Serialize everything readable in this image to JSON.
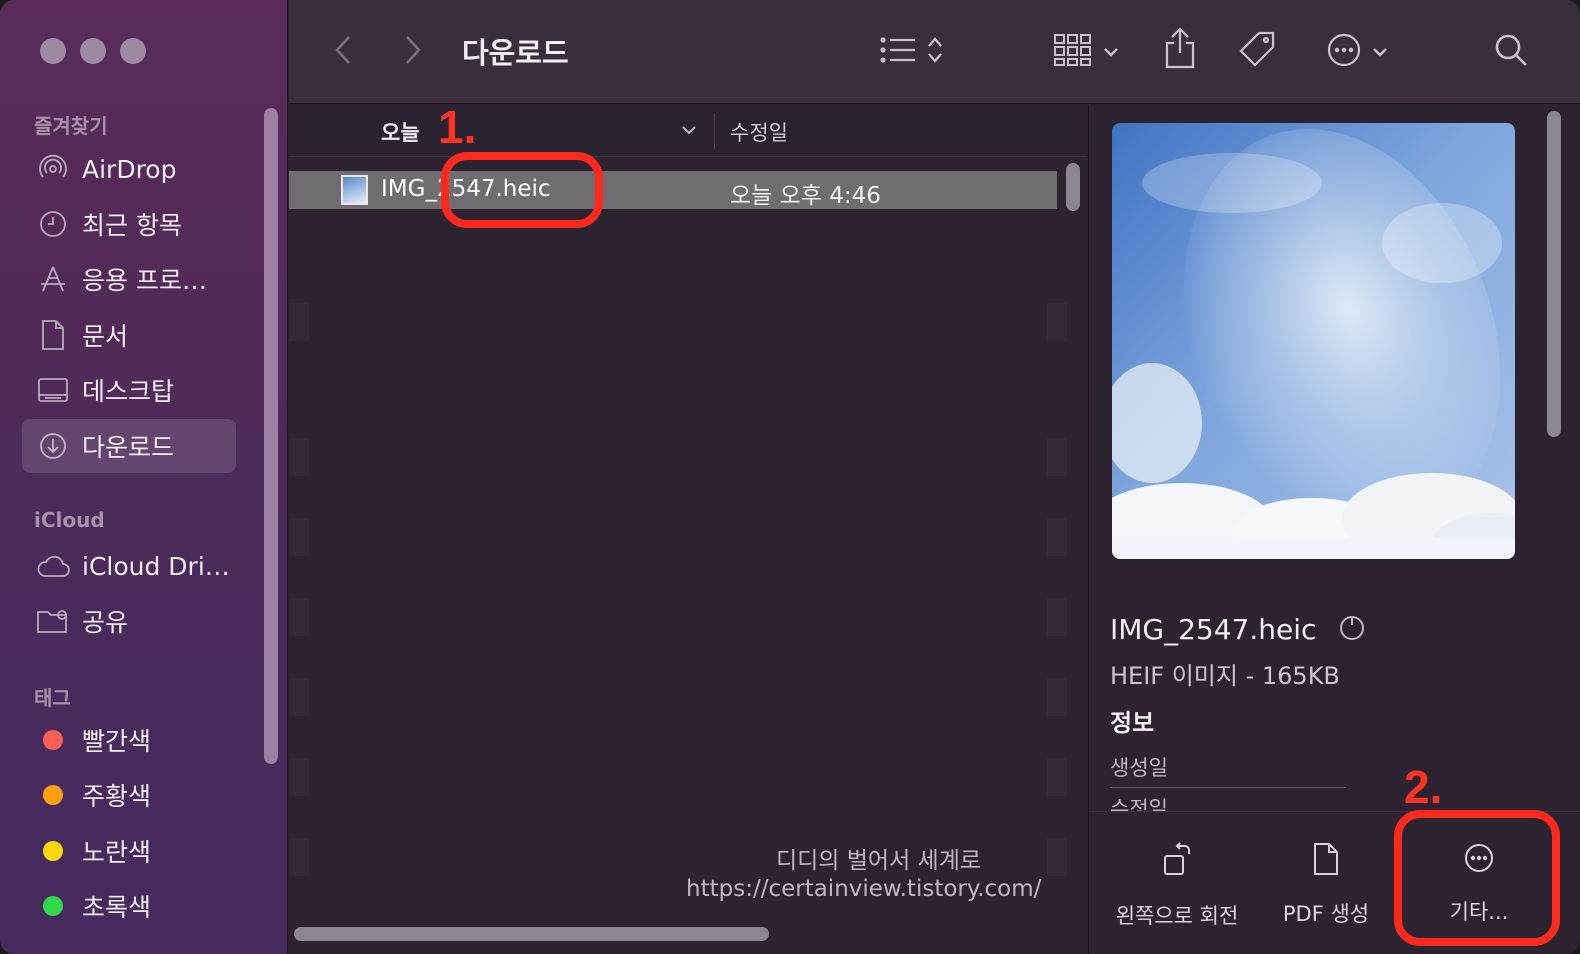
{
  "toolbar": {
    "title": "다운로드",
    "icons": [
      "chevron-left-icon",
      "chevron-right-icon",
      "list-view-icon",
      "grid-view-icon",
      "share-icon",
      "tag-icon",
      "more-icon",
      "search-icon"
    ]
  },
  "sidebar": {
    "favorites_label": "즐겨찾기",
    "favorites": [
      {
        "label": "AirDrop",
        "icon": "airdrop-icon"
      },
      {
        "label": "최근 항목",
        "icon": "clock-icon"
      },
      {
        "label": "응용 프로…",
        "icon": "applications-icon"
      },
      {
        "label": "문서",
        "icon": "document-icon"
      },
      {
        "label": "데스크탑",
        "icon": "desktop-icon"
      },
      {
        "label": "다운로드",
        "icon": "download-icon",
        "active": true
      }
    ],
    "icloud_label": "iCloud",
    "icloud": [
      {
        "label": "iCloud Dri…",
        "icon": "cloud-icon"
      },
      {
        "label": "공유",
        "icon": "shared-folder-icon"
      }
    ],
    "tags_label": "태그",
    "tags": [
      {
        "label": "빨간색",
        "color": "#ff5f57"
      },
      {
        "label": "주황색",
        "color": "#ff9f0a"
      },
      {
        "label": "노란색",
        "color": "#ffd60a"
      },
      {
        "label": "초록색",
        "color": "#32d74b"
      }
    ]
  },
  "list": {
    "group_label": "오늘",
    "column_modified": "수정일",
    "rows": [
      {
        "name": "IMG_2547.heic",
        "modified": "오늘 오후 4:46",
        "selected": true
      }
    ]
  },
  "watermark": {
    "line1": "디디의 벌어서 세계로",
    "line2": "https://certainview.tistory.com/"
  },
  "preview": {
    "filename": "IMG_2547.heic",
    "type_size": "HEIF 이미지 - 165KB",
    "info_label": "정보",
    "created_label": "생성일",
    "modified_label": "수정일",
    "actions": [
      {
        "label": "왼쪽으로 회전",
        "icon": "rotate-left-icon"
      },
      {
        "label": "PDF 생성",
        "icon": "pdf-icon"
      },
      {
        "label": "기타...",
        "icon": "more-icon"
      }
    ]
  },
  "annotations": {
    "step1": "1.",
    "step2": "2.",
    "color": "#ff2a1c"
  }
}
